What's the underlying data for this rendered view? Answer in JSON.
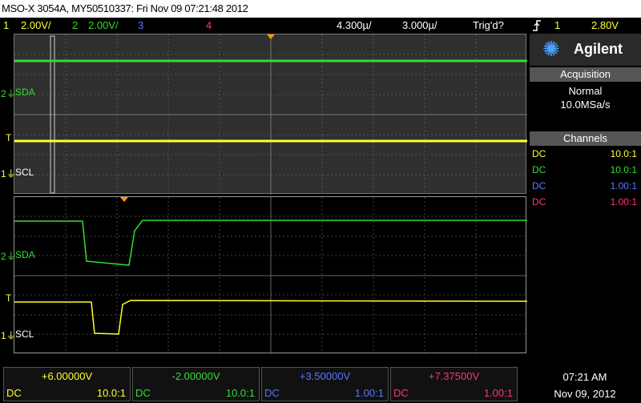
{
  "title": "MSO-X 3054A, MY50510337: Fri Nov 09 07:21:48 2012",
  "status": {
    "ch1_num": "1",
    "ch1_scale": "2.00V/",
    "ch2_num": "2",
    "ch2_scale": "2.00V/",
    "ch3_num": "3",
    "ch4_num": "4",
    "time_pos": "4.300µ/",
    "time_scale": "3.000µ/",
    "trig_status": "Trig'd?",
    "trig_icon": "trigger-edge-icon",
    "trig_source": "1",
    "trig_level": "2.80V"
  },
  "brand": {
    "name": "Agilent"
  },
  "acquisition": {
    "header": "Acquisition",
    "mode": "Normal",
    "rate": "10.0MSa/s"
  },
  "channels": {
    "header": "Channels",
    "rows": [
      {
        "coupling": "DC",
        "probe": "10.0:1",
        "color": "#ffff33"
      },
      {
        "coupling": "DC",
        "probe": "10.0:1",
        "color": "#33dd33"
      },
      {
        "coupling": "DC",
        "probe": "1.00:1",
        "color": "#5577ff"
      },
      {
        "coupling": "DC",
        "probe": "1.00:1",
        "color": "#ff3377"
      }
    ]
  },
  "labels": {
    "sda": "SDA",
    "scl": "SCL",
    "ch2_marker": "2",
    "ch1_marker": "1",
    "trig_marker": "T"
  },
  "softkeys": [
    {
      "offset": "+6.00000V",
      "coupling": "DC",
      "probe": "10.0:1",
      "color": "#ffff33"
    },
    {
      "offset": "-2.00000V",
      "coupling": "DC",
      "probe": "10.0:1",
      "color": "#33dd33"
    },
    {
      "offset": "+3.50000V",
      "coupling": "DC",
      "probe": "1.00:1",
      "color": "#5577ff"
    },
    {
      "offset": "+7.37500V",
      "coupling": "DC",
      "probe": "1.00:1",
      "color": "#ff3377"
    }
  ],
  "clock": {
    "time": "07:21 AM",
    "date": "Nov 09, 2012"
  }
}
